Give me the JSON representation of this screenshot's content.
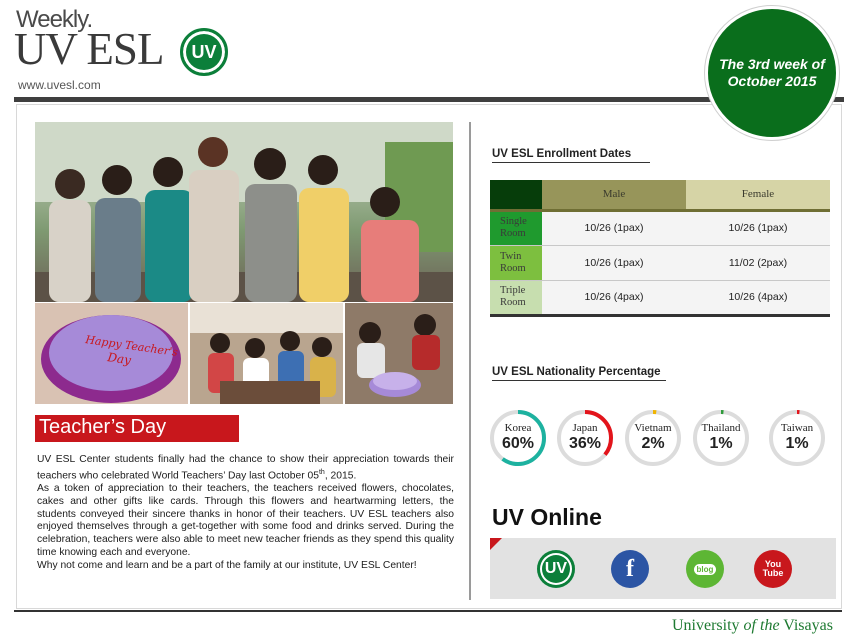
{
  "header": {
    "weekly_label": "Weekly.",
    "brand_name": "UV ESL",
    "logo_text": "UV",
    "site_url": "www.uvesl.com",
    "badge_line1": "The 3rd week of",
    "badge_line2": "October 2015"
  },
  "article": {
    "title": "Teacher’s Day",
    "paragraph1_pre": "UV ESL Center students finally had the chance to show their appreciation towards their teachers who celebrated World Teachers’ Day last October 05",
    "paragraph1_sup": "th",
    "paragraph1_post": ", 2015.",
    "paragraph2": "As a token of appreciation to their teachers, the teachers received flowers, chocolates, cakes and other gifts like cards. Through this flowers and heartwarming letters, the students conveyed their sincere thanks in honor of their teachers. UV ESL teachers also enjoyed themselves through a get-together with some food and drinks served. During the celebration, teachers were also able to meet new teacher friends as they spend this quality time knowing each and everyone.",
    "paragraph3": "Why not come and learn and be a part of the family at our institute, UV ESL Center!",
    "cake_text": "Happy Teacher's Day"
  },
  "enrollment": {
    "title": "UV ESL Enrollment Dates",
    "col_male": "Male",
    "col_female": "Female",
    "rows": [
      {
        "room": "Single Room",
        "male": "10/26 (1pax)",
        "female": "10/26 (1pax)"
      },
      {
        "room": "Twin Room",
        "male": "10/26 (1pax)",
        "female": "11/02 (2pax)"
      },
      {
        "room": "Triple Room",
        "male": "10/26 (4pax)",
        "female": "10/26 (4pax)"
      }
    ]
  },
  "nationality": {
    "title": "UV ESL Nationality Percentage",
    "items": [
      {
        "country": "Korea",
        "label": "60%",
        "percent": 60,
        "color": "#1db2a0"
      },
      {
        "country": "Japan",
        "label": "36%",
        "percent": 36,
        "color": "#e3141b"
      },
      {
        "country": "Vietnam",
        "label": "2%",
        "percent": 2,
        "color": "#f0b400"
      },
      {
        "country": "Thailand",
        "label": "1%",
        "percent": 1,
        "color": "#2e9b3a"
      },
      {
        "country": "Taiwan",
        "label": "1%",
        "percent": 1,
        "color": "#e3141b"
      }
    ]
  },
  "online": {
    "title": "UV Online",
    "uv_icon_text": "UV",
    "facebook_icon_text": "f",
    "blog_icon_text": "blog",
    "youtube_icon_text_1": "You",
    "youtube_icon_text_2": "Tube"
  },
  "footer": {
    "part1": "University ",
    "part2": "of the",
    "part3": " Visayas"
  }
}
